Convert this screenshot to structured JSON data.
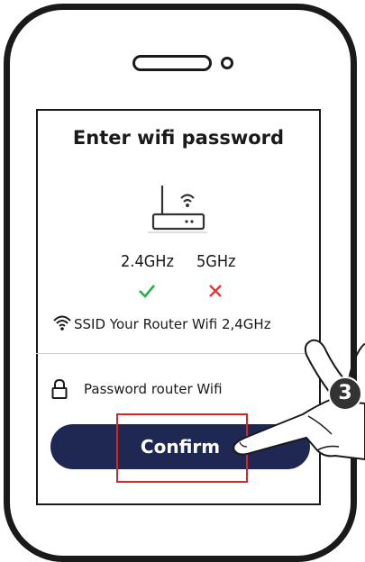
{
  "screen": {
    "title": "Enter wifi password"
  },
  "bands": [
    {
      "label": "2.4GHz",
      "status": "supported",
      "status_icon": "check-icon",
      "status_color": "#22b14c"
    },
    {
      "label": "5GHz",
      "status": "unsupported",
      "status_icon": "cross-icon",
      "status_color": "#e53935"
    }
  ],
  "ssid": {
    "text": "SSID Your Router Wifi 2,4GHz",
    "icon": "wifi-icon"
  },
  "password": {
    "placeholder": "Password router Wifi",
    "icon": "lock-icon"
  },
  "confirm": {
    "label": "Confirm",
    "color": "#1f2852"
  },
  "step": {
    "number": "3",
    "highlight_color": "#e02424"
  }
}
